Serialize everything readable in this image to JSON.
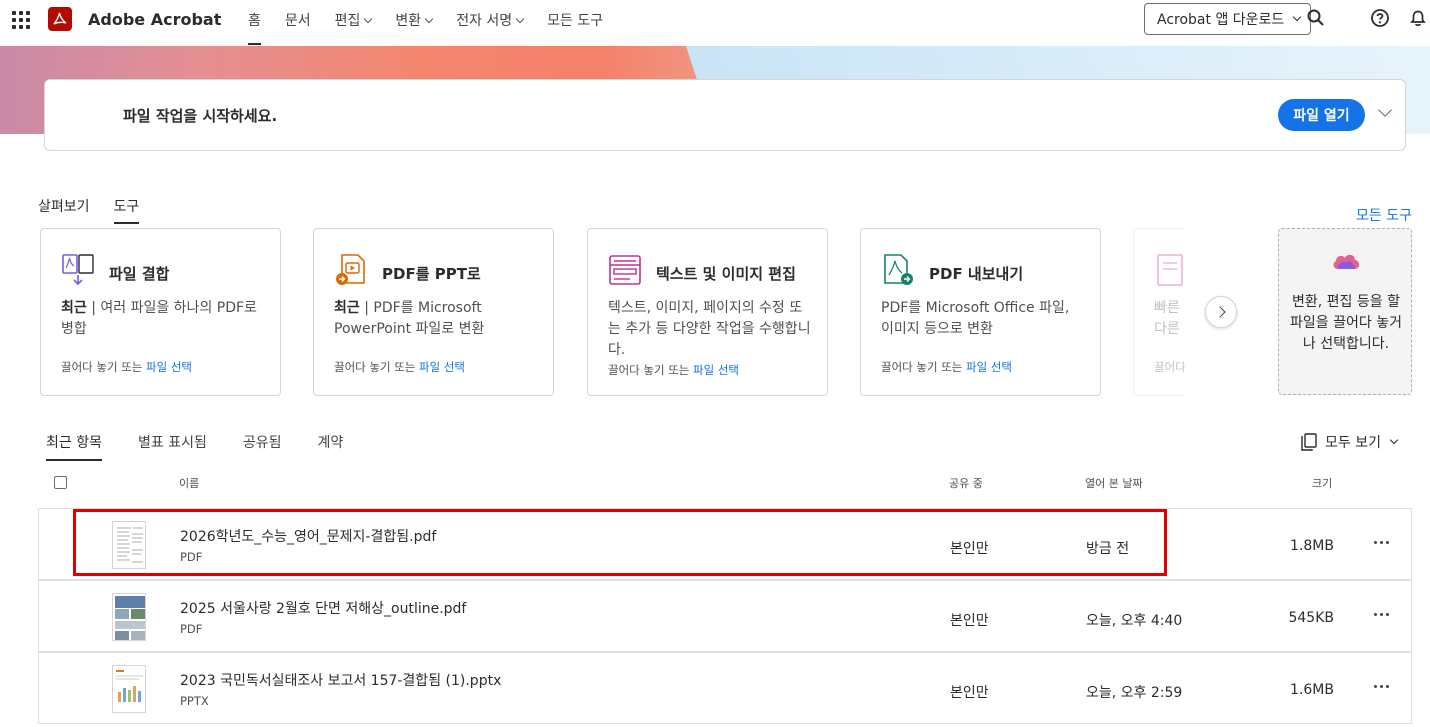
{
  "app": {
    "name": "Adobe Acrobat"
  },
  "nav": {
    "items": [
      {
        "label": "홈",
        "dropdown": false,
        "active": true
      },
      {
        "label": "문서",
        "dropdown": false
      },
      {
        "label": "편집",
        "dropdown": true
      },
      {
        "label": "변환",
        "dropdown": true
      },
      {
        "label": "전자 서명",
        "dropdown": true
      },
      {
        "label": "모든 도구",
        "dropdown": false
      }
    ],
    "download_label": "Acrobat 앱 다운로드"
  },
  "start": {
    "text": "파일 작업을 시작하세요.",
    "open_label": "파일 열기"
  },
  "tabs_top": {
    "items": [
      "살펴보기",
      "도구"
    ],
    "active": "도구",
    "all_tools_link": "모든 도구"
  },
  "tools": [
    {
      "title": "파일 결합",
      "desc_prefix": "최근",
      "desc": " | 여러 파일을 하나의 PDF로 병합",
      "foot": "끌어다 놓기 또는 ",
      "foot_link": "파일 선택",
      "icon": "combine-files-icon"
    },
    {
      "title": "PDF를 PPT로",
      "desc_prefix": "최근",
      "desc": " | PDF를 Microsoft PowerPoint 파일로 변환",
      "foot": "끌어다 놓기 또는 ",
      "foot_link": "파일 선택",
      "icon": "pdf-to-ppt-icon"
    },
    {
      "title": "텍스트 및 이미지 편집",
      "desc_prefix": "",
      "desc": "텍스트, 이미지, 페이지의 수정 또는 추가 등 다양한 작업을 수행합니다.",
      "foot": "끌어다 놓기 또는 ",
      "foot_link": "파일 선택",
      "icon": "edit-text-image-icon"
    },
    {
      "title": "PDF 내보내기",
      "desc_prefix": "",
      "desc": "PDF를 Microsoft Office 파일, 이미지 등으로 변환",
      "foot": "끌어다 놓기 또는 ",
      "foot_link": "파일 선택",
      "icon": "export-pdf-icon"
    }
  ],
  "faded_tool": {
    "desc": "빠른 다른",
    "foot": "끌어다"
  },
  "drop_zone": {
    "text": "변환, 편집 등을 할 파일을 끌어다 놓거나 선택합니다."
  },
  "tabs_recent": {
    "items": [
      "최근 항목",
      "별표 표시됨",
      "공유됨",
      "계약"
    ],
    "active": "최근 항목",
    "view_all": "모두 보기"
  },
  "table": {
    "headers": {
      "name": "이름",
      "shared": "공유 중",
      "opened": "열어 본 날짜",
      "size": "크기"
    },
    "rows": [
      {
        "name": "2026학년도_수능_영어_문제지-결합됨.pdf",
        "type": "PDF",
        "shared": "본인만",
        "opened": "방금 전",
        "size": "1.8MB"
      },
      {
        "name": "2025 서울사랑 2월호 단면 저해상_outline.pdf",
        "type": "PDF",
        "shared": "본인만",
        "opened": "오늘, 오후 4:40",
        "size": "545KB"
      },
      {
        "name": "2023 국민독서실태조사 보고서 157-결합됨 (1).pptx",
        "type": "PPTX",
        "shared": "본인만",
        "opened": "오늘, 오후 2:59",
        "size": "1.6MB"
      }
    ]
  },
  "colors": {
    "accent": "#1473e6",
    "brand": "#b30b00",
    "highlight": "#e00000"
  }
}
